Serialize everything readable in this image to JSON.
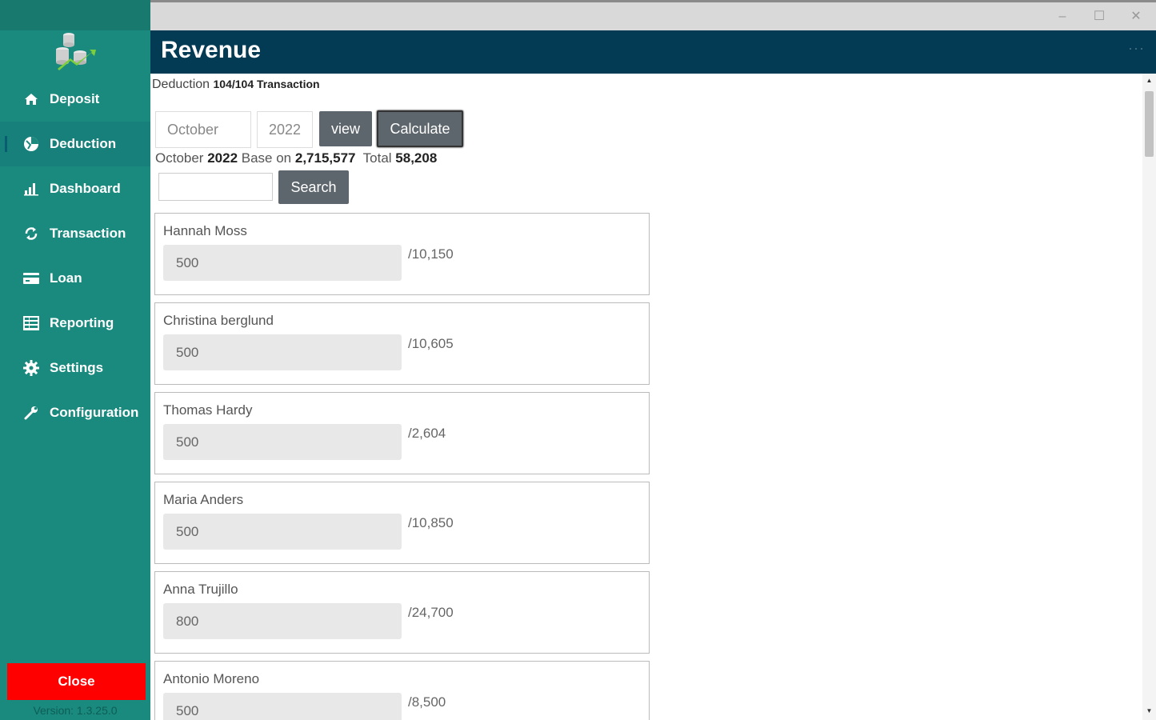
{
  "window": {
    "minimize_label": "–",
    "maximize_label": "☐",
    "close_label": "✕"
  },
  "sidebar": {
    "items": [
      {
        "label": "Deposit",
        "icon": "home-icon"
      },
      {
        "label": "Deduction",
        "icon": "deduction-icon"
      },
      {
        "label": "Dashboard",
        "icon": "bar-chart-icon"
      },
      {
        "label": "Transaction",
        "icon": "sync-icon"
      },
      {
        "label": "Loan",
        "icon": "card-icon"
      },
      {
        "label": "Reporting",
        "icon": "table-icon"
      },
      {
        "label": "Settings",
        "icon": "gear-icon"
      },
      {
        "label": "Configuration",
        "icon": "wrench-icon"
      }
    ],
    "active": "Deduction",
    "close_label": "Close",
    "version": "Version: 1.3.25.0"
  },
  "header": {
    "title": "Revenue",
    "dots": "···"
  },
  "main": {
    "subtitle_prefix": "Deduction ",
    "subtitle_count": "104/104 Transaction",
    "month": "October",
    "year": "2022",
    "view_label": "view",
    "calculate_label": "Calculate",
    "summary": {
      "month": "October ",
      "year": "2022",
      "base_label": " Base on ",
      "base_value": "2,715,577",
      "total_label": "  Total ",
      "total_value": "58,208"
    },
    "search_value": "",
    "search_label": "Search",
    "entries": [
      {
        "name": "Hannah Moss",
        "amount": "500",
        "total": "/10,150"
      },
      {
        "name": "Christina berglund",
        "amount": "500",
        "total": "/10,605"
      },
      {
        "name": "Thomas Hardy",
        "amount": "500",
        "total": "/2,604"
      },
      {
        "name": "Maria Anders",
        "amount": "500",
        "total": "/10,850"
      },
      {
        "name": "Anna Trujillo",
        "amount": "800",
        "total": "/24,700"
      },
      {
        "name": "Antonio Moreno",
        "amount": "500",
        "total": "/8,500"
      }
    ]
  },
  "colors": {
    "sidebar": "#1a8a7e",
    "header": "#033a54",
    "close_button": "#ff0000",
    "button": "#5e666d"
  }
}
